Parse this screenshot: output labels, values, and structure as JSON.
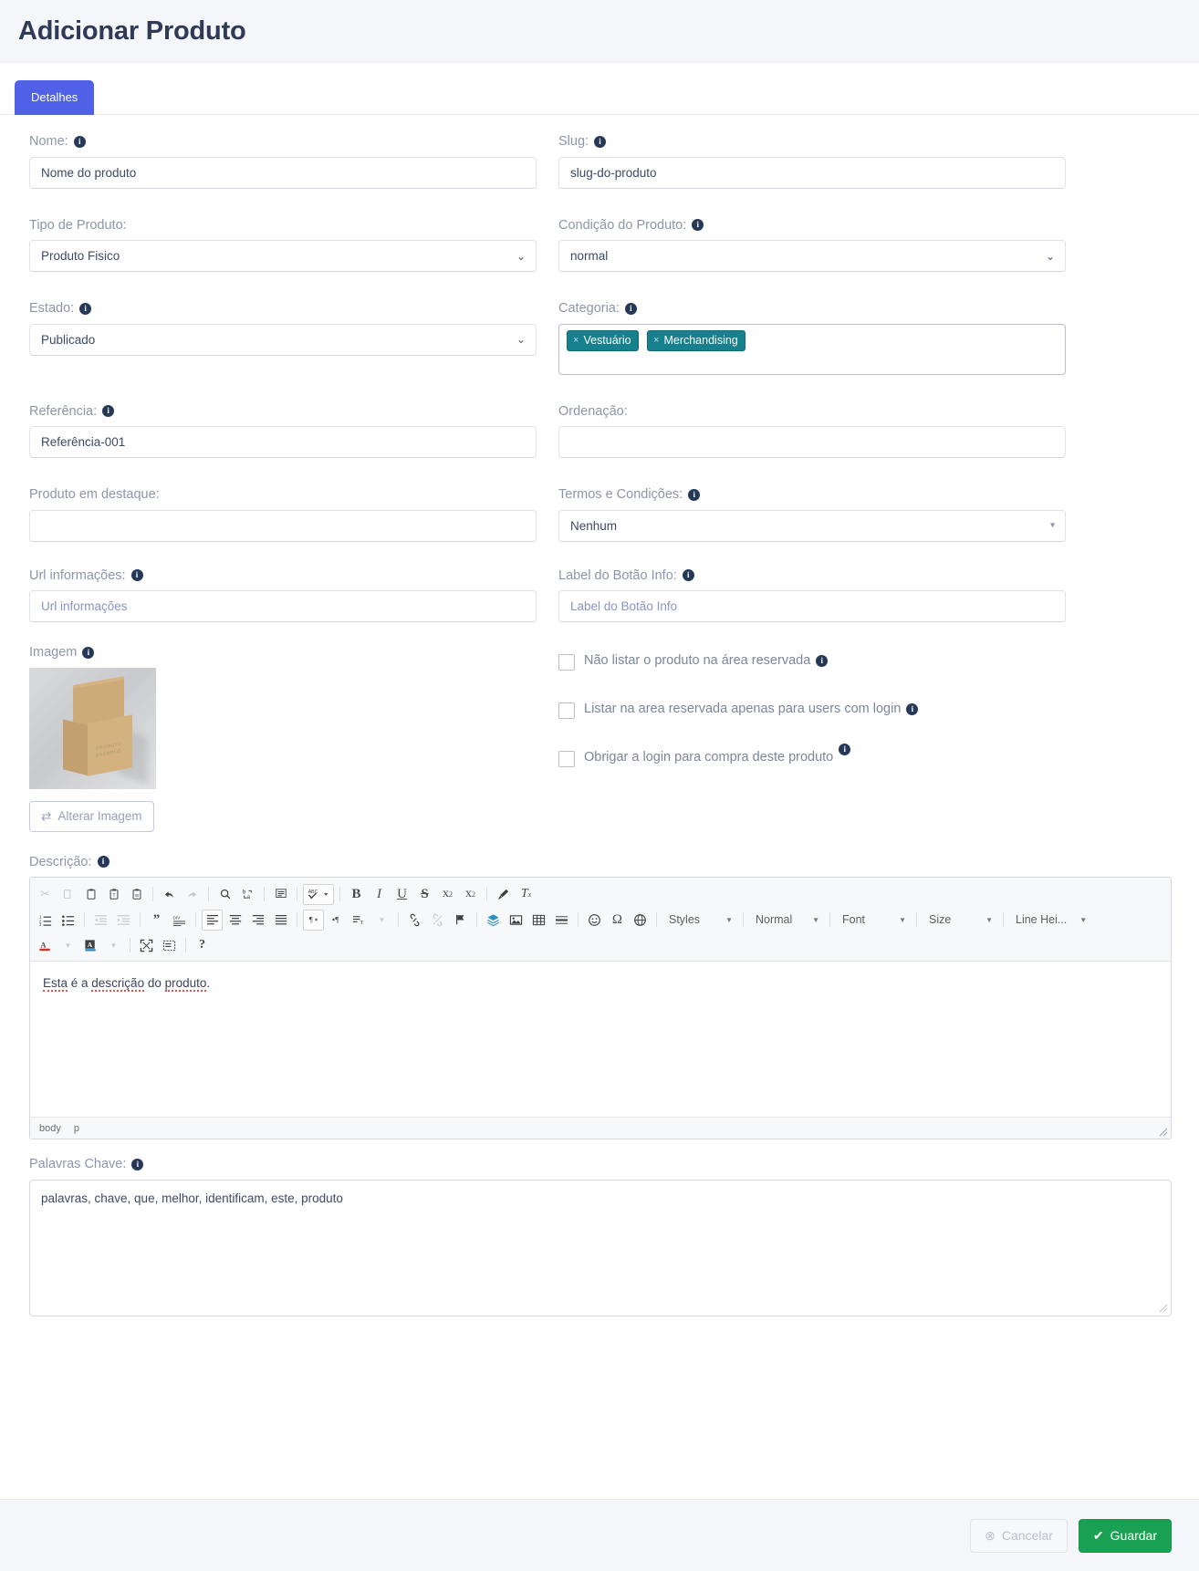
{
  "header": {
    "title": "Adicionar Produto"
  },
  "tabs": [
    {
      "label": "Detalhes"
    }
  ],
  "form": {
    "nome": {
      "label": "Nome:",
      "value": "Nome do produto"
    },
    "slug": {
      "label": "Slug:",
      "value": "slug-do-produto"
    },
    "tipo": {
      "label": "Tipo de Produto:",
      "value": "Produto Fisico"
    },
    "condicao": {
      "label": "Condição do Produto:",
      "value": "normal"
    },
    "estado": {
      "label": "Estado:",
      "value": "Publicado"
    },
    "categoria": {
      "label": "Categoria:",
      "tags": [
        "Vestuário",
        "Merchandising"
      ]
    },
    "referencia": {
      "label": "Referência:",
      "value": "Referência-001"
    },
    "ordenacao": {
      "label": "Ordenação:",
      "value": ""
    },
    "destaque": {
      "label": "Produto em destaque:",
      "value": ""
    },
    "termos": {
      "label": "Termos e Condições:",
      "value": "Nenhum"
    },
    "url_info": {
      "label": "Url informações:",
      "placeholder": "Url informações"
    },
    "label_botao": {
      "label": "Label do Botão Info:",
      "placeholder": "Label do Botão Info"
    },
    "imagem": {
      "label": "Imagem",
      "change_button": "Alterar Imagem",
      "thumb_caption": "PRODUTO EXEMPLO"
    },
    "checkboxes": [
      {
        "label": "Não listar o produto na área reservada",
        "checked": false
      },
      {
        "label": "Listar na area reservada apenas para users com login",
        "checked": false
      },
      {
        "label": "Obrigar a login para compra deste produto",
        "checked": false
      }
    ],
    "descricao": {
      "label": "Descrição:",
      "content_prefix": "Esta",
      "content": " é a descrição do produto.",
      "word_esta": "Esta",
      "word_e_a": " é a ",
      "word_descricao": "descrição",
      "word_do": " do ",
      "word_produto": "produto",
      "word_dot": ".",
      "path": [
        "body",
        "p"
      ]
    },
    "palavras_chave": {
      "label": "Palavras Chave:",
      "value": "palavras, chave, que, melhor, identificam, este, produto"
    }
  },
  "editor_toolbar": {
    "row1": [
      {
        "name": "cut-icon",
        "glyph": "✂",
        "dim": true
      },
      {
        "name": "copy-icon",
        "glyph": "⧉",
        "dim": true
      },
      {
        "name": "paste-icon",
        "glyph": "📋",
        "dim": false
      },
      {
        "name": "paste-text-icon",
        "glyph": "T",
        "dim": false
      },
      {
        "name": "paste-word-icon",
        "glyph": "W",
        "dim": false
      },
      {
        "name": "undo-icon",
        "glyph": "↰",
        "dim": false
      },
      {
        "name": "redo-icon",
        "glyph": "↱",
        "dim": true
      },
      {
        "name": "find-icon",
        "glyph": "🔍",
        "dim": false
      },
      {
        "name": "replace-icon",
        "glyph": "ba",
        "dim": false
      },
      {
        "name": "select-all-icon",
        "glyph": "▤",
        "dim": false
      },
      {
        "name": "spellcheck-icon",
        "glyph": "ABC",
        "dim": false
      },
      {
        "name": "bold-icon",
        "glyph": "B",
        "dim": false
      },
      {
        "name": "italic-icon",
        "glyph": "I",
        "dim": false
      },
      {
        "name": "underline-icon",
        "glyph": "U",
        "dim": false
      },
      {
        "name": "strikethrough-icon",
        "glyph": "S",
        "dim": false
      },
      {
        "name": "subscript-icon",
        "glyph": "x₂",
        "dim": false
      },
      {
        "name": "superscript-icon",
        "glyph": "x²",
        "dim": false
      },
      {
        "name": "remove-format-brush-icon",
        "glyph": "🖌",
        "dim": false
      },
      {
        "name": "clear-formatting-icon",
        "glyph": "Tx",
        "dim": false
      }
    ],
    "row2": [
      {
        "name": "numbered-list-icon"
      },
      {
        "name": "bulleted-list-icon"
      },
      {
        "name": "outdent-icon"
      },
      {
        "name": "indent-icon"
      },
      {
        "name": "blockquote-icon"
      },
      {
        "name": "create-div-icon"
      },
      {
        "name": "align-left-icon"
      },
      {
        "name": "align-center-icon"
      },
      {
        "name": "align-right-icon"
      },
      {
        "name": "justify-icon"
      },
      {
        "name": "ltr-icon"
      },
      {
        "name": "rtl-icon"
      },
      {
        "name": "language-icon"
      },
      {
        "name": "link-icon"
      },
      {
        "name": "unlink-icon"
      },
      {
        "name": "anchor-icon"
      },
      {
        "name": "media-embed-icon"
      },
      {
        "name": "image-icon"
      },
      {
        "name": "table-icon"
      },
      {
        "name": "horizontal-rule-icon"
      },
      {
        "name": "smiley-icon"
      },
      {
        "name": "special-char-icon"
      },
      {
        "name": "iframe-icon"
      }
    ],
    "row3": [
      {
        "name": "text-color-icon"
      },
      {
        "name": "background-color-icon"
      },
      {
        "name": "maximize-icon"
      },
      {
        "name": "show-blocks-icon"
      },
      {
        "name": "about-help-icon"
      }
    ],
    "combos": [
      {
        "name": "styles-combo",
        "label": "Styles"
      },
      {
        "name": "format-combo",
        "label": "Normal"
      },
      {
        "name": "font-combo",
        "label": "Font"
      },
      {
        "name": "size-combo",
        "label": "Size"
      },
      {
        "name": "line-height-combo",
        "label": "Line Hei..."
      }
    ]
  },
  "footer": {
    "cancel": "Cancelar",
    "save": "Guardar"
  },
  "colors": {
    "tab_blue": "#5061e8",
    "tag_teal": "#17808e",
    "save_green": "#1aa053",
    "header_bg": "#f4f6fa",
    "info_badge": "#253858"
  }
}
